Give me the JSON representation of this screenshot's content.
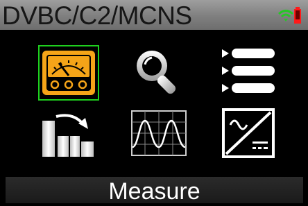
{
  "title_bar": {
    "title": "DVBC/C2/MCNS",
    "status_icons": [
      "wifi-icon",
      "battery-icon"
    ],
    "colors": {
      "wifi": "#26c826",
      "battery": "#ff1a1a"
    }
  },
  "menu": {
    "tiles": [
      {
        "name": "meter",
        "icon": "meter-icon",
        "selected": true
      },
      {
        "name": "search",
        "icon": "search-icon",
        "selected": false
      },
      {
        "name": "list",
        "icon": "list-icon",
        "selected": false
      },
      {
        "name": "bar-chart",
        "icon": "bar-chart-arrow-icon",
        "selected": false
      },
      {
        "name": "waveform",
        "icon": "waveform-icon",
        "selected": false
      },
      {
        "name": "ac-dc",
        "icon": "ac-dc-icon",
        "selected": false
      }
    ],
    "colors": {
      "accent": "#f5a418",
      "selection": "#1ecf1e"
    }
  },
  "footer": {
    "label": "Measure"
  }
}
